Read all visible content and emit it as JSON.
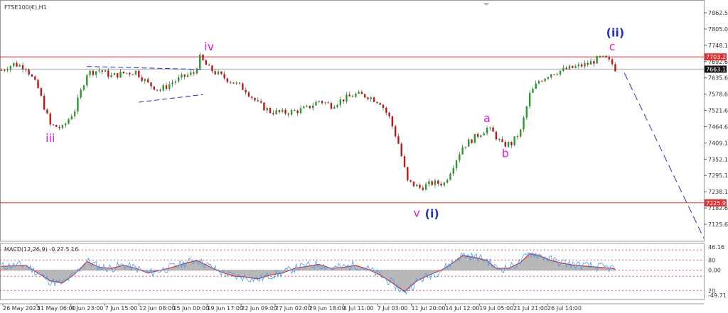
{
  "chart_data": {
    "type": "line",
    "title": "FTSE100(€),H1",
    "colors": {
      "up": "#2a9a2a",
      "down": "#c01818",
      "wick": "#333333",
      "level": "#e03030",
      "wave_pink": "#e020e0",
      "wave_blue": "#2030c0",
      "macd_line": "#3aa0ff",
      "signal_line": "#e02020",
      "histogram": "#b8b8b8"
    },
    "price_axis": {
      "ylim": [
        7100,
        7880
      ],
      "ticks": [
        "7862.5",
        "7805.0",
        "7748.1",
        "7692.6",
        "7635.6",
        "7578.6",
        "7521.6",
        "7464.6",
        "7409.1",
        "7352.1",
        "7295.1",
        "7238.1",
        "7182.6",
        "7125.6"
      ]
    },
    "x_ticks": [
      "26 May 2023",
      "31 May 06:00",
      "4 Jun 23:00",
      "7 Jun 15:00",
      "12 Jun 08:00",
      "15 Jun 00:00",
      "19 Jun 17:00",
      "22 Jun 09:00",
      "27 Jun 02:00",
      "29 Jun 18:00",
      "4 Jul 11:00",
      "7 Jul 03:00",
      "11 Jul 20:00",
      "14 Jul 12:00",
      "19 Jul 05:00",
      "21 Jul 21:00",
      "26 Jul 14:00"
    ],
    "price_path": [
      [
        0,
        7660
      ],
      [
        4,
        7680
      ],
      [
        8,
        7670
      ],
      [
        12,
        7600
      ],
      [
        16,
        7480
      ],
      [
        20,
        7470
      ],
      [
        24,
        7530
      ],
      [
        28,
        7650
      ],
      [
        32,
        7660
      ],
      [
        36,
        7640
      ],
      [
        40,
        7650
      ],
      [
        44,
        7655
      ],
      [
        48,
        7615
      ],
      [
        52,
        7595
      ],
      [
        56,
        7620
      ],
      [
        60,
        7640
      ],
      [
        63,
        7650
      ],
      [
        65,
        7700
      ],
      [
        68,
        7665
      ],
      [
        72,
        7640
      ],
      [
        76,
        7620
      ],
      [
        80,
        7595
      ],
      [
        84,
        7550
      ],
      [
        88,
        7525
      ],
      [
        92,
        7520
      ],
      [
        96,
        7525
      ],
      [
        100,
        7535
      ],
      [
        104,
        7560
      ],
      [
        108,
        7545
      ],
      [
        112,
        7565
      ],
      [
        116,
        7580
      ],
      [
        120,
        7575
      ],
      [
        124,
        7555
      ],
      [
        127,
        7505
      ],
      [
        130,
        7420
      ],
      [
        133,
        7295
      ],
      [
        137,
        7275
      ],
      [
        141,
        7290
      ],
      [
        145,
        7290
      ],
      [
        148,
        7350
      ],
      [
        151,
        7410
      ],
      [
        155,
        7440
      ],
      [
        159,
        7470
      ],
      [
        161,
        7455
      ],
      [
        164,
        7415
      ],
      [
        167,
        7420
      ],
      [
        170,
        7460
      ],
      [
        173,
        7580
      ],
      [
        176,
        7625
      ],
      [
        180,
        7650
      ],
      [
        184,
        7660
      ],
      [
        188,
        7670
      ],
      [
        192,
        7680
      ],
      [
        196,
        7700
      ],
      [
        198,
        7695
      ],
      [
        200,
        7680
      ],
      [
        201,
        7665
      ]
    ],
    "levels": [
      7703.2,
      7663.1,
      7225.9
    ],
    "level_labels": [
      "7703.2",
      "7663.1",
      "7225.9"
    ],
    "projection": [
      [
        204,
        7650
      ],
      [
        230,
        7110
      ]
    ],
    "triangle": {
      "upper": [
        [
          28,
          7672
        ],
        [
          66,
          7662
        ]
      ],
      "lower": [
        [
          45,
          7555
        ],
        [
          66,
          7580
        ]
      ]
    },
    "wave_labels": [
      {
        "text": "iii",
        "t": 16,
        "p": 7425,
        "style": "pink"
      },
      {
        "text": "iv",
        "t": 68,
        "p": 7725,
        "style": "pink"
      },
      {
        "text": "v",
        "t": 136,
        "p": 7180,
        "style": "pink"
      },
      {
        "text": "(i)",
        "t": 141,
        "p": 7178,
        "style": "blue"
      },
      {
        "text": "a",
        "t": 159,
        "p": 7490,
        "style": "pink"
      },
      {
        "text": "b",
        "t": 165,
        "p": 7375,
        "style": "pink"
      },
      {
        "text": "c",
        "t": 200,
        "p": 7725,
        "style": "pink"
      },
      {
        "text": "(ii)",
        "t": 201,
        "p": 7770,
        "style": "blue"
      }
    ],
    "macd": {
      "label": "MACD(12,26,9) -0.27 5.16",
      "ylim": [
        -55,
        50
      ],
      "ticks": [
        "46.16",
        "0.00",
        "-49.71"
      ],
      "right_labels": [
        "80",
        "20"
      ],
      "dashed_levels": [
        40,
        20,
        0,
        -12,
        -40
      ],
      "histogram": [
        [
          0,
          8
        ],
        [
          8,
          10
        ],
        [
          12,
          -6
        ],
        [
          16,
          -22
        ],
        [
          20,
          -26
        ],
        [
          24,
          -8
        ],
        [
          28,
          18
        ],
        [
          32,
          6
        ],
        [
          36,
          4
        ],
        [
          40,
          10
        ],
        [
          44,
          4
        ],
        [
          48,
          -6
        ],
        [
          52,
          0
        ],
        [
          56,
          6
        ],
        [
          60,
          14
        ],
        [
          64,
          20
        ],
        [
          68,
          8
        ],
        [
          72,
          -4
        ],
        [
          76,
          -12
        ],
        [
          80,
          -14
        ],
        [
          84,
          -18
        ],
        [
          88,
          -10
        ],
        [
          92,
          -6
        ],
        [
          96,
          4
        ],
        [
          100,
          8
        ],
        [
          104,
          12
        ],
        [
          108,
          4
        ],
        [
          112,
          6
        ],
        [
          116,
          10
        ],
        [
          120,
          2
        ],
        [
          124,
          -10
        ],
        [
          128,
          -26
        ],
        [
          132,
          -44
        ],
        [
          136,
          -22
        ],
        [
          140,
          -10
        ],
        [
          144,
          0
        ],
        [
          148,
          16
        ],
        [
          151,
          30
        ],
        [
          155,
          26
        ],
        [
          159,
          20
        ],
        [
          162,
          4
        ],
        [
          166,
          4
        ],
        [
          170,
          16
        ],
        [
          173,
          34
        ],
        [
          176,
          30
        ],
        [
          180,
          20
        ],
        [
          184,
          14
        ],
        [
          188,
          10
        ],
        [
          192,
          8
        ],
        [
          196,
          6
        ],
        [
          200,
          4
        ],
        [
          201,
          2
        ]
      ]
    }
  }
}
